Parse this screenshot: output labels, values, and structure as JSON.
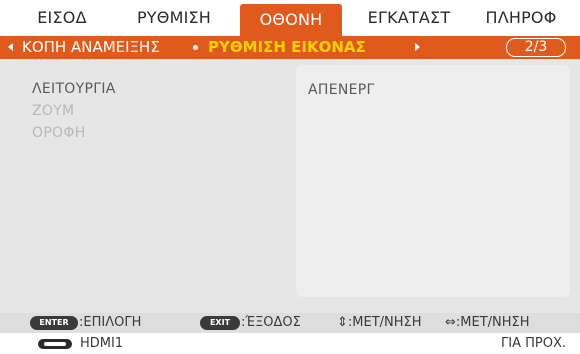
{
  "tabs": [
    {
      "label": "ΕΙΣΟΔ"
    },
    {
      "label": "ΡΥΘΜΙΣΗ"
    },
    {
      "label": "ΟΘΟΝΗ"
    },
    {
      "label": "ΕΓΚΑΤΑΣΤ"
    },
    {
      "label": "ΠΛΗΡΟΦ"
    }
  ],
  "active_tab": "ΟΘΟΝΗ",
  "breadcrumb": {
    "parent": "ΚΟΠΗ ΑΝΑΜΕΙΞΗΣ",
    "current": "ΡΥΘΜΙΣΗ ΕΙΚΟΝΑΣ",
    "page": "2/3"
  },
  "menu": {
    "items": [
      {
        "label": "ΛΕΙΤΟΥΡΓΙΑ",
        "enabled": true
      },
      {
        "label": "ΖΟΥΜ",
        "enabled": false
      },
      {
        "label": "ΟΡΟΦΗ",
        "enabled": false
      }
    ],
    "selected_value": "ΑΠΕΝΕΡΓ"
  },
  "guide": {
    "enter_key": "ENTER",
    "enter_action": ":ΕΠΙΛΟΓΗ",
    "exit_key": "EXIT",
    "exit_action": ":ΈΞΟΔΟΣ",
    "updown_action": "⇕:ΜΕΤ/ΝΗΣΗ",
    "leftright_action": "⇔:ΜΕΤ/ΝΗΣΗ"
  },
  "status": {
    "source": "HDMI1",
    "right_text": "ΓΙΑ ΠΡΟΧ."
  },
  "colors": {
    "accent": "#e15a1d",
    "highlight_text": "#ffd200",
    "panel_bg": "#e6e6e6"
  },
  "icons": {
    "hdmi": "hdmi-connector-icon"
  }
}
